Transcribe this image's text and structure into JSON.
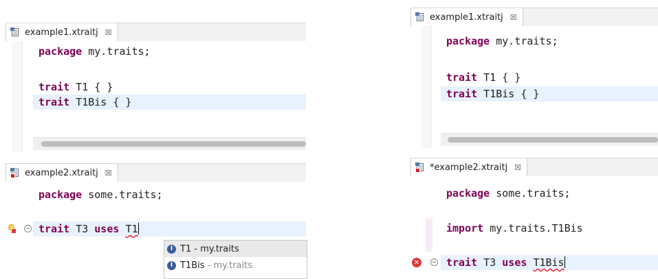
{
  "left": {
    "tab1": {
      "title": "example1.xtraitj",
      "close": "☒"
    },
    "editor1": {
      "line1": {
        "kw": "package",
        "rest": " my.traits;"
      },
      "line2": {
        "kw": "trait",
        "rest": " T1 { }"
      },
      "line3": {
        "kw": "trait",
        "rest": " T1Bis { }"
      }
    },
    "tab2": {
      "title": "example2.xtraitj",
      "close": "☒"
    },
    "editor2": {
      "line1": {
        "kw": "package",
        "rest": " some.traits;"
      },
      "line2": {
        "kw1": "trait",
        "mid": " T3 ",
        "kw2": "uses",
        "space": " ",
        "ref": "T1"
      }
    },
    "content_assist": [
      {
        "icon": "I",
        "name": "T1",
        "sep": " - ",
        "pkg": "my.traits"
      },
      {
        "icon": "I",
        "name": "T1Bis",
        "sep": " - ",
        "pkg": "my.traits"
      }
    ]
  },
  "right": {
    "tab1": {
      "title": "example1.xtraitj",
      "close": "☒"
    },
    "editor1": {
      "line1": {
        "kw": "package",
        "rest": " my.traits;"
      },
      "line2": {
        "kw": "trait",
        "rest": " T1 { }"
      },
      "line3": {
        "kw": "trait",
        "rest": " T1Bis { }"
      }
    },
    "tab2": {
      "title": "*example2.xtraitj",
      "close": "☒"
    },
    "editor2": {
      "line1": {
        "kw": "package",
        "rest": " some.traits;"
      },
      "line2": {
        "kw": "import",
        "rest": " my.traits.T1Bis"
      },
      "line3": {
        "kw1": "trait",
        "mid": " T3 ",
        "kw2": "uses",
        "space": " ",
        "ref": "T1Bis"
      }
    },
    "error_marker": "✕"
  },
  "colors": {
    "keyword": "#7f0055",
    "current_line": "#e8f2fe",
    "error": "#d83b3b"
  }
}
